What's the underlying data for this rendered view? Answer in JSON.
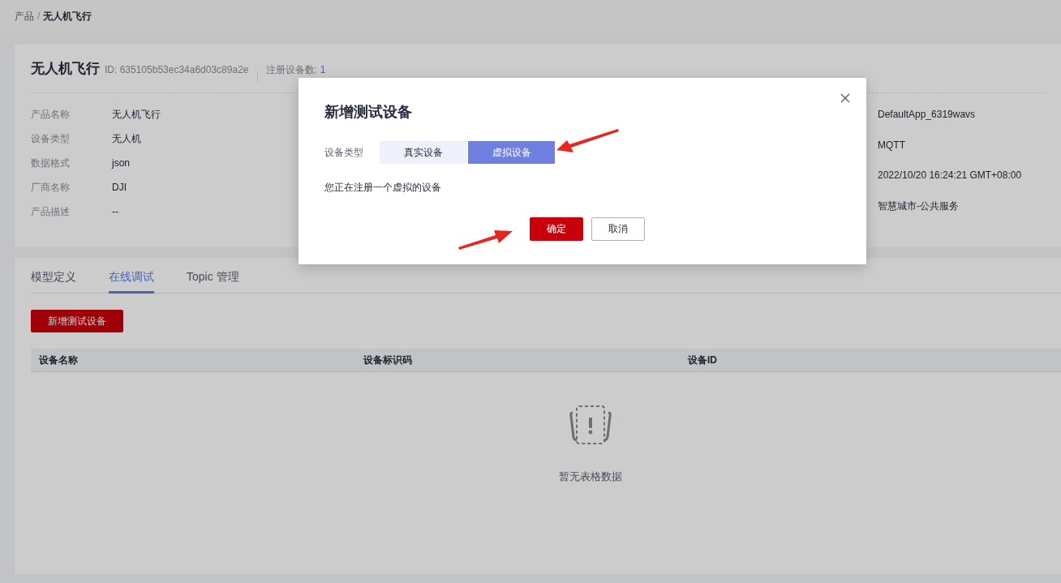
{
  "breadcrumb": {
    "items": [
      "产品",
      "无人机飞行"
    ],
    "separator": "/"
  },
  "product": {
    "name": "无人机飞行",
    "id": "ID: 635105b53ec34a6d03c89a2e",
    "count_label": "注册设备数:",
    "count": "1"
  },
  "details_left": [
    {
      "label": "产品名称",
      "value": "无人机飞行"
    },
    {
      "label": "设备类型",
      "value": "无人机"
    },
    {
      "label": "数据格式",
      "value": "json"
    },
    {
      "label": "厂商名称",
      "value": "DJI"
    },
    {
      "label": "产品描述",
      "value": "--"
    }
  ],
  "details_right": [
    "DefaultApp_6319wavs",
    "MQTT",
    "2022/10/20 16:24:21 GMT+08:00",
    "智慧城市-公共服务"
  ],
  "tabs": [
    {
      "label": "模型定义",
      "selected": false
    },
    {
      "label": "在线调试",
      "selected": true
    },
    {
      "label": "Topic 管理",
      "selected": false
    }
  ],
  "add_button": "新增测试设备",
  "table": {
    "columns": [
      "设备名称",
      "设备标识码",
      "设备ID"
    ],
    "empty_text": "暂无表格数据"
  },
  "dialog": {
    "title": "新增测试设备",
    "field_label": "设备类型",
    "options": [
      {
        "label": "真实设备",
        "selected": false
      },
      {
        "label": "虚拟设备",
        "selected": true
      }
    ],
    "message": "您正在注册一个虚拟的设备",
    "buttons": [
      {
        "label": "确定",
        "kind": "primary"
      },
      {
        "label": "取消",
        "kind": "default"
      }
    ]
  }
}
